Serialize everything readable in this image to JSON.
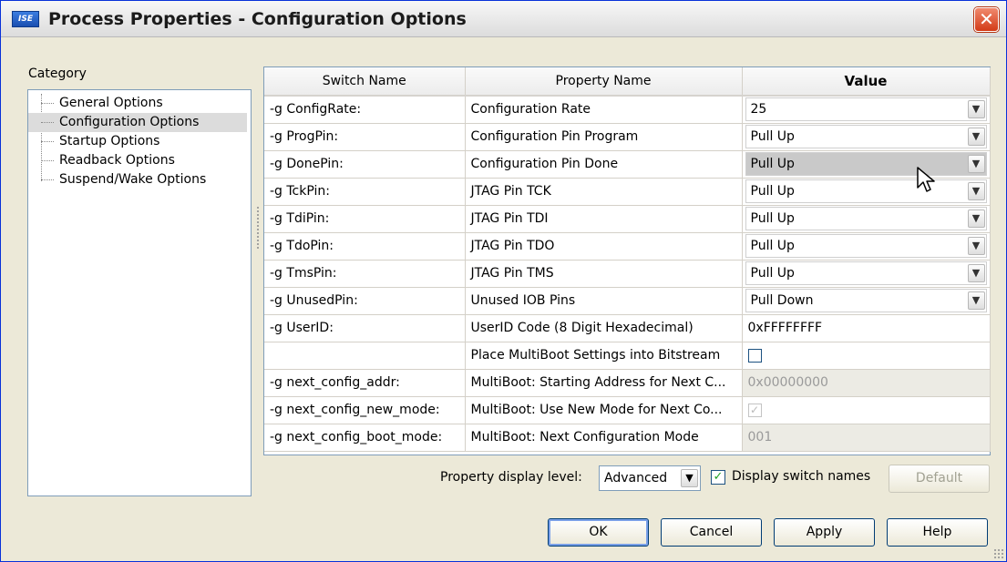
{
  "window": {
    "title": "Process Properties - Configuration Options",
    "app_icon_text": "ISE",
    "close_glyph": "✕"
  },
  "category": {
    "label": "Category",
    "items": [
      {
        "label": "General Options",
        "selected": false
      },
      {
        "label": "Configuration Options",
        "selected": true
      },
      {
        "label": "Startup Options",
        "selected": false
      },
      {
        "label": "Readback Options",
        "selected": false
      },
      {
        "label": "Suspend/Wake Options",
        "selected": false
      }
    ]
  },
  "grid": {
    "headers": {
      "switch": "Switch Name",
      "property": "Property Name",
      "value": "Value"
    },
    "rows": [
      {
        "switch": "-g ConfigRate:",
        "property": "Configuration Rate",
        "value": "25",
        "kind": "combo"
      },
      {
        "switch": "-g ProgPin:",
        "property": "Configuration Pin Program",
        "value": "Pull Up",
        "kind": "combo"
      },
      {
        "switch": "-g DonePin:",
        "property": "Configuration Pin Done",
        "value": "Pull Up",
        "kind": "combo",
        "highlight": true
      },
      {
        "switch": "-g TckPin:",
        "property": "JTAG Pin TCK",
        "value": "Pull Up",
        "kind": "combo"
      },
      {
        "switch": "-g TdiPin:",
        "property": "JTAG Pin TDI",
        "value": "Pull Up",
        "kind": "combo"
      },
      {
        "switch": "-g TdoPin:",
        "property": "JTAG Pin TDO",
        "value": "Pull Up",
        "kind": "combo"
      },
      {
        "switch": "-g TmsPin:",
        "property": "JTAG Pin TMS",
        "value": "Pull Up",
        "kind": "combo"
      },
      {
        "switch": "-g UnusedPin:",
        "property": "Unused IOB Pins",
        "value": "Pull Down",
        "kind": "combo"
      },
      {
        "switch": "-g UserID:",
        "property": "UserID Code (8 Digit Hexadecimal)",
        "value": "0xFFFFFFFF",
        "kind": "text"
      },
      {
        "switch": "",
        "property": "Place MultiBoot Settings into Bitstream",
        "value": "",
        "kind": "checkbox"
      },
      {
        "switch": "-g next_config_addr:",
        "property": "MultiBoot: Starting Address for Next C...",
        "value": "0x00000000",
        "kind": "disabled-text"
      },
      {
        "switch": "-g next_config_new_mode:",
        "property": "MultiBoot: Use New Mode for Next Co...",
        "value": "✓",
        "kind": "disabled-checkbox"
      },
      {
        "switch": "-g next_config_boot_mode:",
        "property": "MultiBoot: Next Configuration Mode",
        "value": "001",
        "kind": "disabled-text"
      }
    ]
  },
  "footer": {
    "display_level_label": "Property display level:",
    "display_level_value": "Advanced",
    "display_switch_names_label": "Display switch names",
    "display_switch_names_checked": "✓",
    "default_button": "Default",
    "ok_button": "OK",
    "cancel_button": "Cancel",
    "apply_button": "Apply",
    "help_button": "Help"
  },
  "icons": {
    "dropdown_arrow": "❯",
    "cursor": "pointer-cursor-icon"
  }
}
